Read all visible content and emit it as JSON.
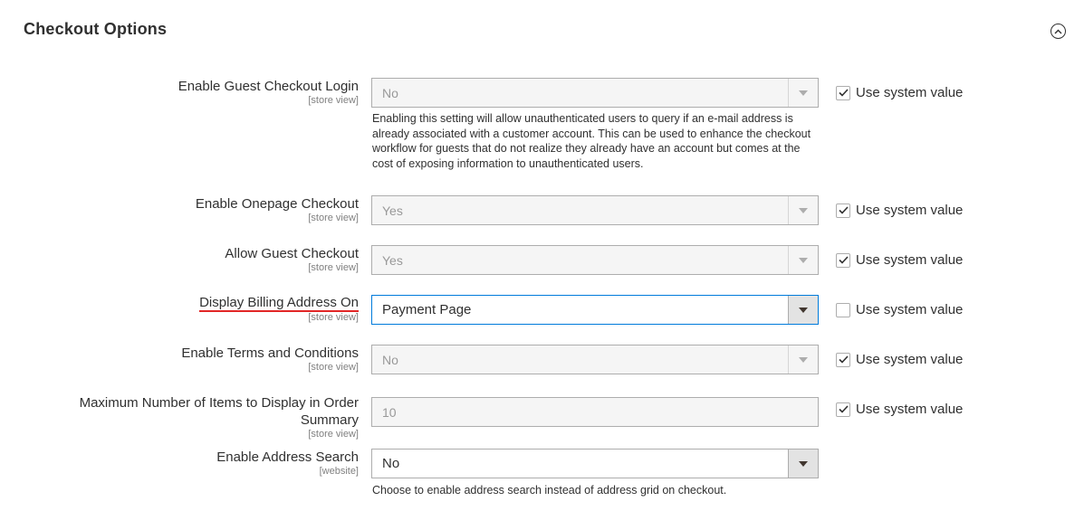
{
  "section": {
    "title": "Checkout Options",
    "collapse_icon": "chevron-up-circle-icon"
  },
  "fields": [
    {
      "label": "Enable Guest Checkout Login",
      "scope": "[store view]",
      "value": "No",
      "control": "select",
      "disabled": true,
      "note": "Enabling this setting will allow unauthenticated users to query if an e-mail address is already associated with a customer account. This can be used to enhance the checkout workflow for guests that do not realize they already have an account but comes at the cost of exposing information to unauthenticated users.",
      "use_system_value": true,
      "use_system_label": "Use system value"
    },
    {
      "label": "Enable Onepage Checkout",
      "scope": "[store view]",
      "value": "Yes",
      "control": "select",
      "disabled": true,
      "use_system_value": true,
      "use_system_label": "Use system value"
    },
    {
      "label": "Allow Guest Checkout",
      "scope": "[store view]",
      "value": "Yes",
      "control": "select",
      "disabled": true,
      "use_system_value": true,
      "use_system_label": "Use system value"
    },
    {
      "label": "Display Billing Address On",
      "scope": "[store view]",
      "value": "Payment Page",
      "control": "select",
      "disabled": false,
      "use_system_value": false,
      "use_system_label": "Use system value"
    },
    {
      "label": "Enable Terms and Conditions",
      "scope": "[store view]",
      "value": "No",
      "control": "select",
      "disabled": true,
      "use_system_value": true,
      "use_system_label": "Use system value"
    },
    {
      "label_line1": "Maximum Number of Items to Display in Order",
      "label_line2": "Summary",
      "scope": "[store view]",
      "value": "10",
      "control": "text",
      "disabled": true,
      "use_system_value": true,
      "use_system_label": "Use system value"
    },
    {
      "label": "Enable Address Search",
      "scope": "[website]",
      "value": "No",
      "control": "select",
      "disabled": false,
      "note": "Choose to enable address search instead of address grid on checkout."
    }
  ],
  "colors": {
    "focus_border": "#007bdb",
    "underline": "#e22626",
    "disabled_bg": "#f5f5f5"
  }
}
